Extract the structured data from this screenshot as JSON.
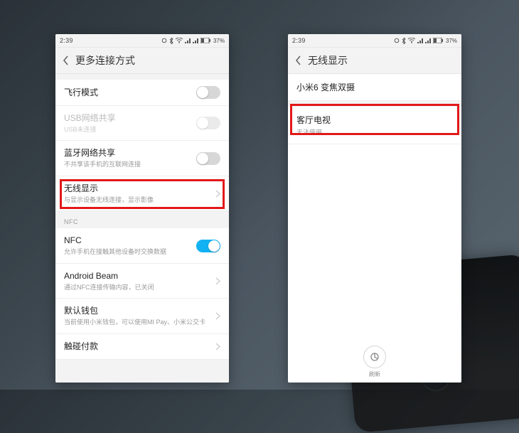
{
  "status": {
    "time": "2:39",
    "battery_pct": "37%"
  },
  "left": {
    "header_title": "更多连接方式",
    "items": {
      "airplane": {
        "title": "飞行模式"
      },
      "usb_tether": {
        "title": "USB网络共享",
        "sub": "USB未连接"
      },
      "bt_tether": {
        "title": "蓝牙网络共享",
        "sub": "不共享该手机的互联网连接"
      },
      "wireless_display": {
        "title": "无线显示",
        "sub": "与显示设备无线连接，显示影像"
      },
      "nfc_section_label": "NFC",
      "nfc": {
        "title": "NFC",
        "sub": "允许手机在接触其他设备时交换数据"
      },
      "android_beam": {
        "title": "Android Beam",
        "sub": "通过NFC连接传输内容，已关闭"
      },
      "default_wallet": {
        "title": "默认钱包",
        "sub": "当前使用小米钱包，可以使用MI Pay、小米公交卡"
      },
      "tap_pay": {
        "title": "触碰付款"
      }
    }
  },
  "right": {
    "header_title": "无线显示",
    "local_device": "小米6 变焦双摄",
    "remote": {
      "title": "客厅电视",
      "sub": "无法使用"
    },
    "refresh_label": "刷新"
  }
}
